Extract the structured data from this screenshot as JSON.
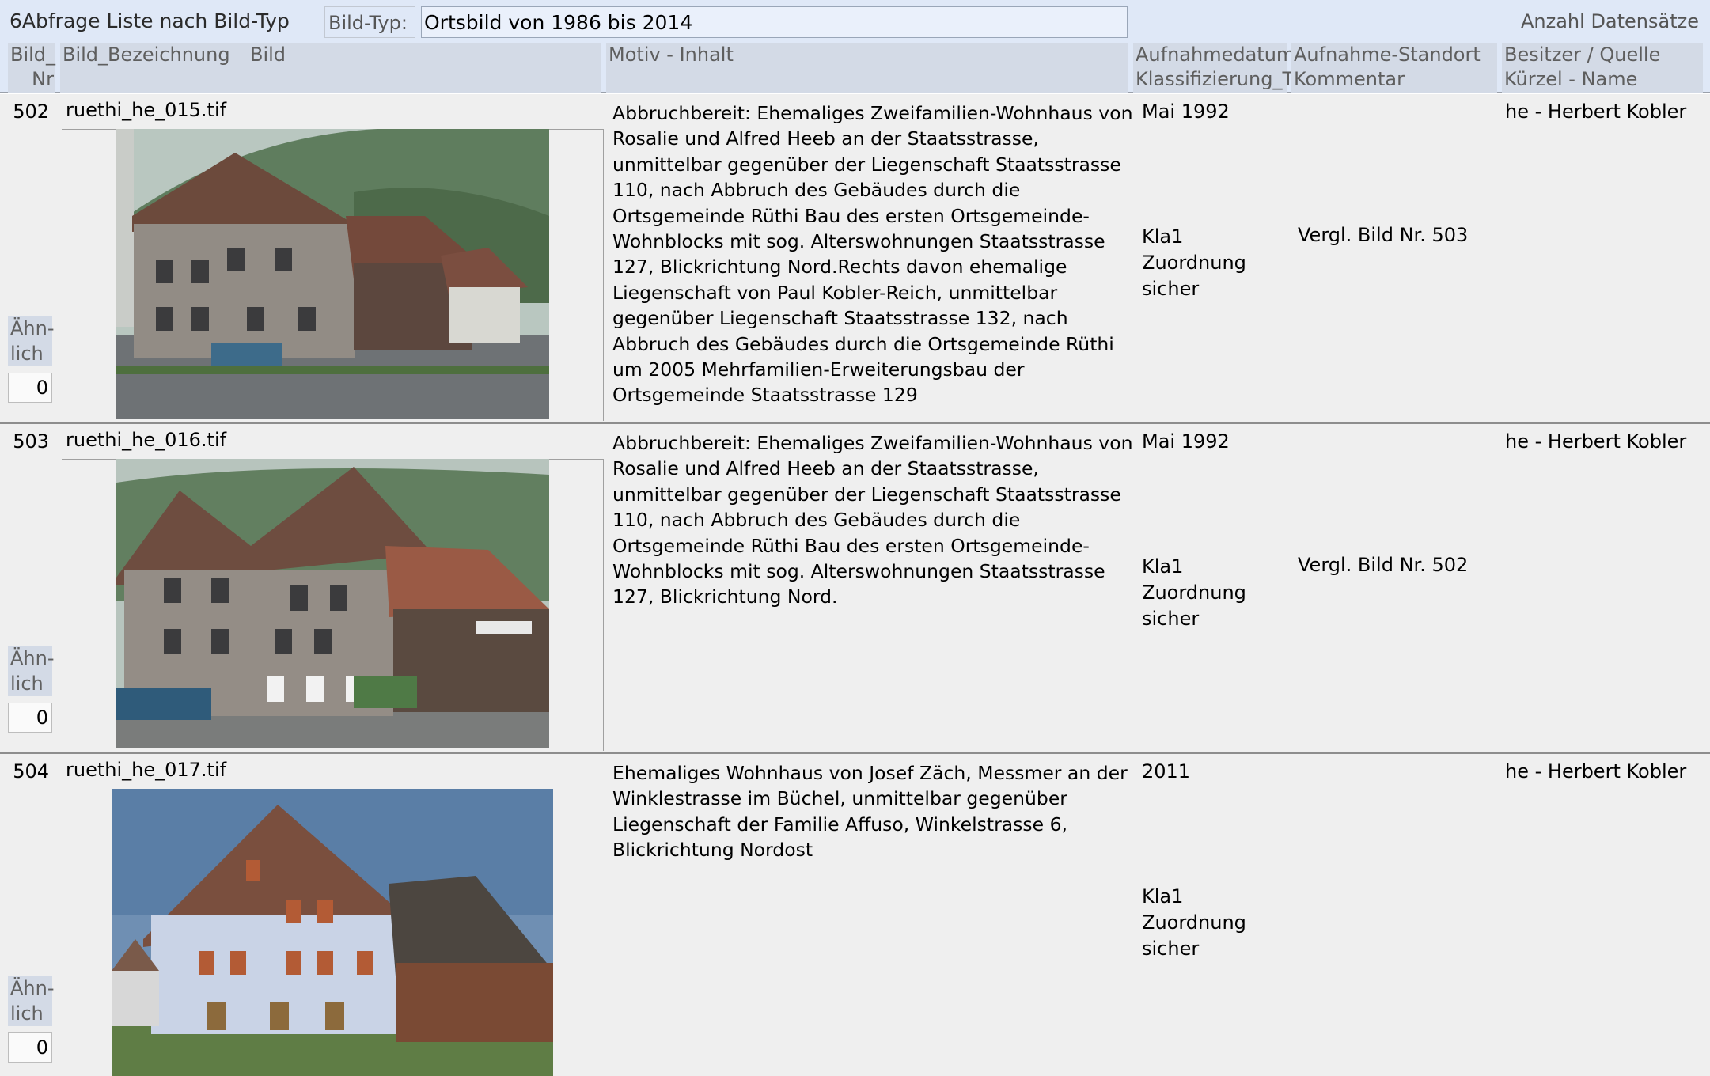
{
  "form": {
    "title": "6Abfrage Liste nach Bild-Typ",
    "bildtyp_label": "Bild-Typ:",
    "bildtyp_value": "Ortsbild von 1986 bis 2014",
    "count_label": "Anzahl Datensätze"
  },
  "columns": {
    "nr_l1": "Bild_",
    "nr_l2": "Nr",
    "bezeichnung": "Bild_Bezeichnung",
    "bild": "Bild",
    "motiv": "Motiv - Inhalt",
    "datum_l1": "Aufnahmedatum",
    "datum_l2": "Klassifizierung_T",
    "standort_l1": "Aufnahme-Standort",
    "standort_l2": "Kommentar",
    "besitzer_l1": "Besitzer / Quelle",
    "besitzer_l2": "Kürzel - Name"
  },
  "records": [
    {
      "nr": "502",
      "file": "ruethi_he_015.tif",
      "motiv": "Abbruchbereit: Ehemaliges Zweifamilien-Wohnhaus von Rosalie und Alfred Heeb an der Staatsstrasse, unmittelbar gegenüber der Liegenschaft Staatsstrasse 110, nach Abbruch des Gebäudes durch die Ortsgemeinde Rüthi Bau des ersten Ortsgemeinde-Wohnblocks mit sog. Alterswohnungen Staatsstrasse 127, Blickrichtung Nord.Rechts davon ehemalige Liegenschaft von Paul Kobler-Reich, unmittelbar gegenüber Liegenschaft Staatsstrasse 132, nach Abbruch des Gebäudes durch die Ortsgemeinde Rüthi um 2005 Mehrfamilien-Erweiterungsbau der Ortsgemeinde Staatsstrasse 129",
      "datum": "Mai 1992",
      "klass": "Kla1 Zuordnung sicher",
      "kommentar": "Vergl. Bild Nr. 503",
      "besitzer": "he - Herbert Kobler",
      "aehnlich_label": "Ähn-lich",
      "aehnlich_value": "0",
      "image_icon": "house-photo-1"
    },
    {
      "nr": "503",
      "file": "ruethi_he_016.tif",
      "motiv": "Abbruchbereit: Ehemaliges Zweifamilien-Wohnhaus von Rosalie und Alfred Heeb an der Staatsstrasse, unmittelbar gegenüber der Liegenschaft Staatsstrasse 110, nach Abbruch des Gebäudes durch die Ortsgemeinde Rüthi Bau des ersten Ortsgemeinde-Wohnblocks mit sog. Alterswohnungen Staatsstrasse 127, Blickrichtung Nord.",
      "datum": "Mai 1992",
      "klass": "Kla1 Zuordnung sicher",
      "kommentar": "Vergl. Bild Nr. 502",
      "besitzer": "he - Herbert Kobler",
      "aehnlich_label": "Ähn-lich",
      "aehnlich_value": "0",
      "image_icon": "house-photo-2"
    },
    {
      "nr": "504",
      "file": "ruethi_he_017.tif",
      "motiv": "Ehemaliges Wohnhaus von Josef Zäch, Messmer an der Winklestrasse im Büchel, unmittelbar gegenüber Liegenschaft der Familie Affuso, Winkelstrasse 6, Blickrichtung Nordost",
      "datum": "2011",
      "klass": "Kla1 Zuordnung sicher",
      "kommentar": "",
      "besitzer": "he - Herbert Kobler",
      "aehnlich_label": "Ähn-lich",
      "aehnlich_value": "0",
      "image_icon": "house-photo-3"
    }
  ]
}
